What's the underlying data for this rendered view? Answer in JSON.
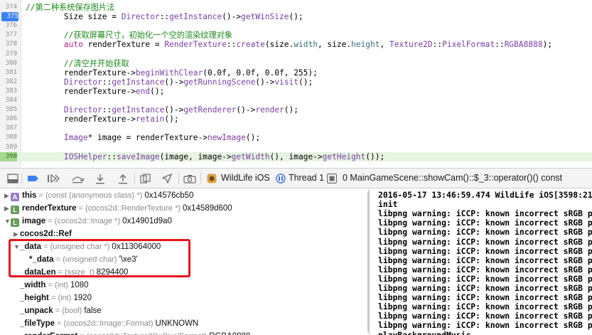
{
  "editor": {
    "lines": [
      {
        "n": "374",
        "parts": [
          {
            "t": "//第二种系统保存图片法",
            "c": "cmt"
          }
        ]
      },
      {
        "n": "375",
        "parts": [
          {
            "t": "        Size size = ",
            "c": ""
          },
          {
            "t": "Director",
            "c": "typ"
          },
          {
            "t": "::",
            "c": ""
          },
          {
            "t": "getInstance",
            "c": "typ"
          },
          {
            "t": "()->",
            "c": ""
          },
          {
            "t": "getWinSize",
            "c": "typ"
          },
          {
            "t": "();",
            "c": ""
          }
        ]
      },
      {
        "n": "376",
        "parts": []
      },
      {
        "n": "377",
        "parts": [
          {
            "t": "        //获取屏幕尺寸，初始化一个空的渲染纹理对象",
            "c": "cmt"
          }
        ]
      },
      {
        "n": "378",
        "parts": [
          {
            "t": "        ",
            "c": ""
          },
          {
            "t": "auto",
            "c": "kw"
          },
          {
            "t": " renderTexture = ",
            "c": ""
          },
          {
            "t": "RenderTexture",
            "c": "typ"
          },
          {
            "t": "::",
            "c": ""
          },
          {
            "t": "create",
            "c": "typ"
          },
          {
            "t": "(size.",
            "c": ""
          },
          {
            "t": "width",
            "c": "mem"
          },
          {
            "t": ", size.",
            "c": ""
          },
          {
            "t": "height",
            "c": "mem"
          },
          {
            "t": ", ",
            "c": ""
          },
          {
            "t": "Texture2D",
            "c": "typ"
          },
          {
            "t": "::",
            "c": ""
          },
          {
            "t": "PixelFormat",
            "c": "typ"
          },
          {
            "t": "::",
            "c": ""
          },
          {
            "t": "RGBA8888",
            "c": "typ"
          },
          {
            "t": ");",
            "c": ""
          }
        ]
      },
      {
        "n": "379",
        "parts": []
      },
      {
        "n": "380",
        "parts": [
          {
            "t": "        //清空并开始获取",
            "c": "cmt"
          }
        ]
      },
      {
        "n": "381",
        "parts": [
          {
            "t": "        renderTexture->",
            "c": ""
          },
          {
            "t": "beginWithClear",
            "c": "typ"
          },
          {
            "t": "(0.0f, 0.0f, 0.0f, 255);",
            "c": ""
          }
        ]
      },
      {
        "n": "382",
        "parts": [
          {
            "t": "        ",
            "c": ""
          },
          {
            "t": "Director",
            "c": "typ"
          },
          {
            "t": "::",
            "c": ""
          },
          {
            "t": "getInstance",
            "c": "typ"
          },
          {
            "t": "()->",
            "c": ""
          },
          {
            "t": "getRunningScene",
            "c": "typ"
          },
          {
            "t": "()->",
            "c": ""
          },
          {
            "t": "visit",
            "c": "typ"
          },
          {
            "t": "();",
            "c": ""
          }
        ]
      },
      {
        "n": "383",
        "parts": [
          {
            "t": "        renderTexture->",
            "c": ""
          },
          {
            "t": "end",
            "c": "typ"
          },
          {
            "t": "();",
            "c": ""
          }
        ]
      },
      {
        "n": "384",
        "parts": []
      },
      {
        "n": "385",
        "parts": [
          {
            "t": "        ",
            "c": ""
          },
          {
            "t": "Director",
            "c": "typ"
          },
          {
            "t": "::",
            "c": ""
          },
          {
            "t": "getInstance",
            "c": "typ"
          },
          {
            "t": "()->",
            "c": ""
          },
          {
            "t": "getRenderer",
            "c": "typ"
          },
          {
            "t": "()->",
            "c": ""
          },
          {
            "t": "render",
            "c": "typ"
          },
          {
            "t": "();",
            "c": ""
          }
        ]
      },
      {
        "n": "386",
        "parts": [
          {
            "t": "        renderTexture->",
            "c": ""
          },
          {
            "t": "retain",
            "c": "typ"
          },
          {
            "t": "();",
            "c": ""
          }
        ]
      },
      {
        "n": "387",
        "parts": []
      },
      {
        "n": "388",
        "parts": [
          {
            "t": "        ",
            "c": ""
          },
          {
            "t": "Image",
            "c": "typ"
          },
          {
            "t": "* image = renderTexture->",
            "c": ""
          },
          {
            "t": "newImage",
            "c": "typ"
          },
          {
            "t": "();",
            "c": ""
          }
        ]
      },
      {
        "n": "389",
        "parts": []
      },
      {
        "n": "390",
        "parts": [
          {
            "t": "        ",
            "c": ""
          },
          {
            "t": "IOSHelper",
            "c": "typ"
          },
          {
            "t": "::",
            "c": ""
          },
          {
            "t": "saveImage",
            "c": "typ"
          },
          {
            "t": "(image, image->",
            "c": ""
          },
          {
            "t": "getWidth",
            "c": "typ"
          },
          {
            "t": "(), image->",
            "c": ""
          },
          {
            "t": "getHeight",
            "c": "typ"
          },
          {
            "t": "());",
            "c": ""
          }
        ]
      }
    ]
  },
  "toolbar": {
    "scheme": "WildLife iOS",
    "thread": "Thread 1",
    "frame": "0 MainGameScene::showCam()::$_3::operator()() const"
  },
  "variables": [
    {
      "tri": "▶",
      "badge": "A",
      "name": "this",
      "type": "(const (anonymous class) *)",
      "value": "0x14576cb50",
      "indent": 0
    },
    {
      "tri": "▶",
      "badge": "L",
      "name": "renderTexture",
      "type": "(cocos2d::RenderTexture *)",
      "value": "0x14589d600",
      "indent": 0
    },
    {
      "tri": "▼",
      "badge": "L",
      "name": "image",
      "type": "(cocos2d::Image *)",
      "value": "0x14901d9a0",
      "indent": 0
    },
    {
      "tri": "▶",
      "badge": "",
      "name": "cocos2d::Ref",
      "type": "",
      "value": "",
      "indent": 1
    },
    {
      "tri": "▼",
      "badge": "",
      "name": "_data",
      "type": "(unsigned char *)",
      "value": "0x113064000",
      "indent": 1
    },
    {
      "tri": "",
      "badge": "",
      "name": "*_data",
      "type": "(unsigned char)",
      "value": "'\\xe3'",
      "indent": 2
    },
    {
      "tri": "",
      "badge": "",
      "name": "_dataLen",
      "type": "(ssize_t)",
      "value": "8294400",
      "indent": 1
    },
    {
      "tri": "",
      "badge": "",
      "name": "_width",
      "type": "(int)",
      "value": "1080",
      "indent": 1
    },
    {
      "tri": "",
      "badge": "",
      "name": "_height",
      "type": "(int)",
      "value": "1920",
      "indent": 1
    },
    {
      "tri": "",
      "badge": "",
      "name": "_unpack",
      "type": "(bool)",
      "value": "false",
      "indent": 1
    },
    {
      "tri": "",
      "badge": "",
      "name": "_fileType",
      "type": "(cocos2d::Image::Format)",
      "value": "UNKNOWN",
      "indent": 1
    },
    {
      "tri": "",
      "badge": "",
      "name": "_renderFormat",
      "type": "(cocos2d::Texture2D::PixelFormat)",
      "value": "RGBA8888",
      "indent": 1
    }
  ],
  "console": [
    "2016-05-17 13:46:59.474 WildLife iOS[3598:2144",
    "init",
    "libpng warning: iCCP: known incorrect sRGB pro",
    "libpng warning: iCCP: known incorrect sRGB pro",
    "libpng warning: iCCP: known incorrect sRGB pro",
    "libpng warning: iCCP: known incorrect sRGB pro",
    "libpng warning: iCCP: known incorrect sRGB pro",
    "libpng warning: iCCP: known incorrect sRGB pro",
    "libpng warning: iCCP: known incorrect sRGB pro",
    "libpng warning: iCCP: known incorrect sRGB pro",
    "libpng warning: iCCP: known incorrect sRGB pro",
    "libpng warning: iCCP: known incorrect sRGB pro",
    "libpng warning: iCCP: known incorrect sRGB pro",
    "libpng warning: iCCP: known incorrect sRGB pro",
    "libpng warning: iCCP: known incorrect sRGB pro",
    "playBackgroundMusic"
  ],
  "colors": {
    "highlight_box": "#e8141f",
    "breakpoint": "#3c80f6",
    "exec_line": "#e6f4e2"
  },
  "icons": [
    "breakpoints-toggle-icon",
    "continue-icon",
    "step-over-icon",
    "step-into-icon",
    "step-out-icon",
    "view-debugger-icon",
    "memory-graph-icon",
    "simulate-location-icon",
    "camera-icon",
    "app-icon",
    "thread-icon",
    "stack-frame-icon"
  ]
}
